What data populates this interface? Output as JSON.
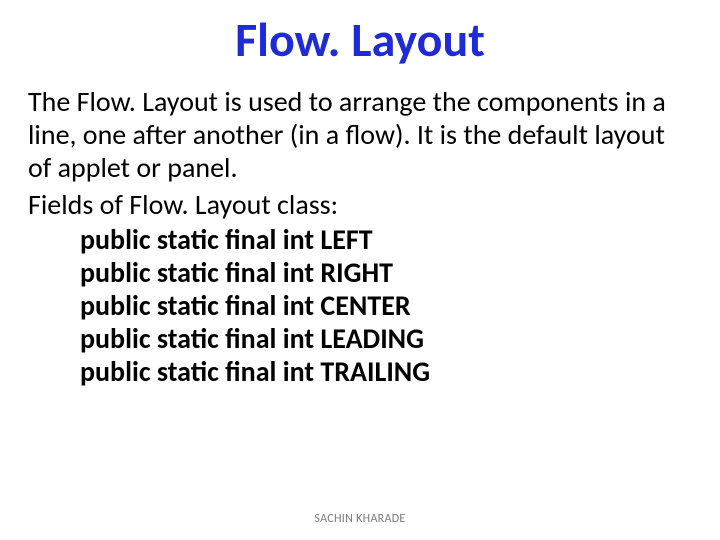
{
  "title": "Flow. Layout",
  "paragraph": "The Flow. Layout is used to arrange the components in a line, one after another (in a flow). It is the default layout of applet or panel.",
  "fields_intro": "Fields of Flow. Layout class:",
  "fields": [
    "public static final int LEFT",
    "public static final int RIGHT",
    "public static final int CENTER",
    "public static final int LEADING",
    "public static final int TRAILING"
  ],
  "footer": "SACHIN KHARADE"
}
